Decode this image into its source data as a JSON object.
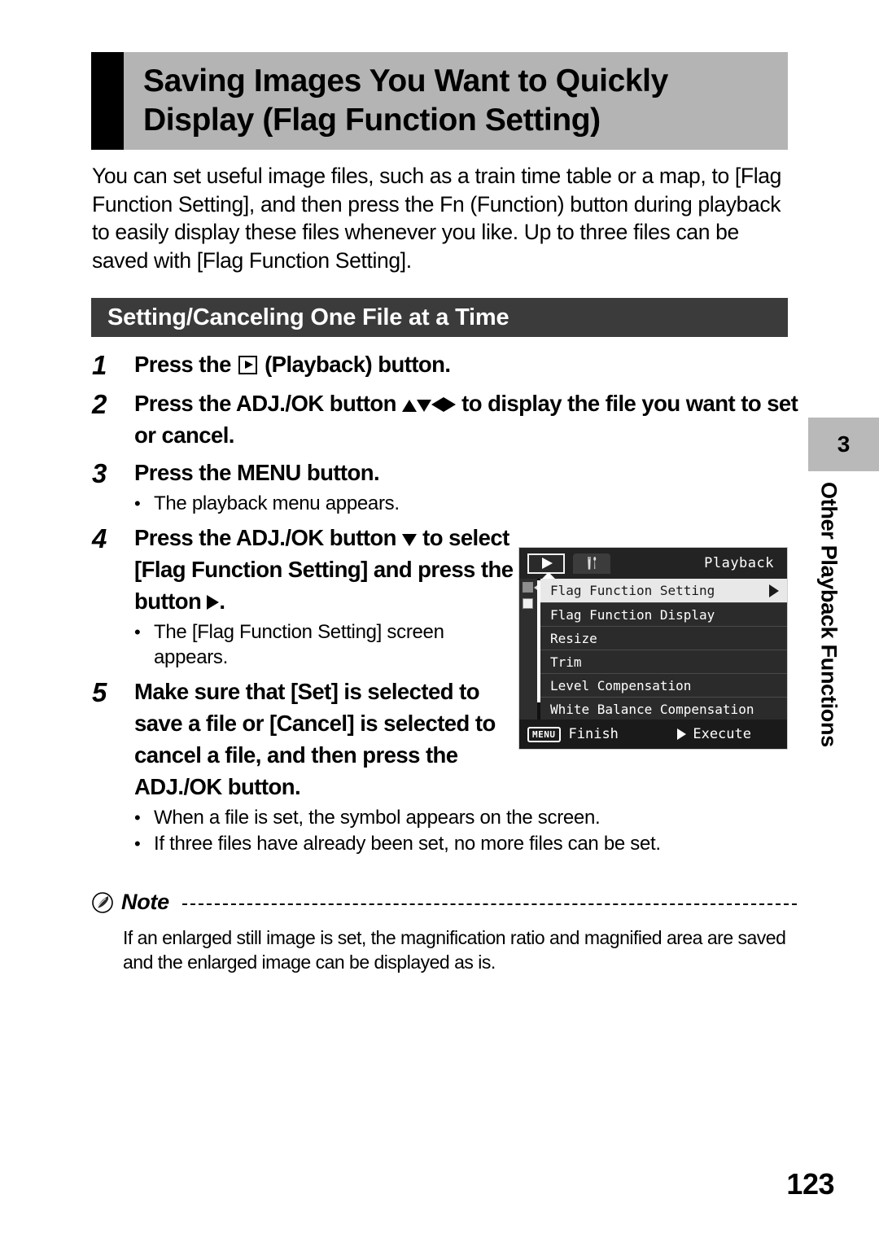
{
  "header": {
    "title_line1": "Saving Images You Want to Quickly",
    "title_line2": "Display (Flag Function Setting)"
  },
  "intro": {
    "paragraph": "You can set useful image files, such as a train time table or a map, to [Flag Function Setting], and then press the Fn (Function) button during playback to easily display these files whenever you like. Up to three files can be saved with [Flag Function Setting]."
  },
  "subsection": {
    "title": "Setting/Canceling One File at a Time"
  },
  "steps": [
    {
      "number": "1",
      "text_before": "Press the",
      "text_after": "(Playback) button."
    },
    {
      "number": "2",
      "text_before": "Press the ADJ./OK button",
      "text_after": "to display the file you want to set or cancel."
    },
    {
      "number": "3",
      "text": "Press the MENU button.",
      "bullets": [
        "The playback menu appears."
      ]
    },
    {
      "number": "4",
      "text_before": "Press the ADJ./OK button",
      "text_mid": "to select [Flag Function Setting] and press the button",
      "text_after": ".",
      "bullets": [
        "The [Flag Function Setting] screen appears."
      ]
    },
    {
      "number": "5",
      "text": "Make sure that [Set] is selected to save a file or [Cancel] is selected to cancel a file, and then press the ADJ./OK button.",
      "bullets": [
        "When a file is set, the symbol appears on the screen.",
        "If three files have already been set, no more files can be set."
      ]
    }
  ],
  "lcd": {
    "tabs": [
      {
        "icon": "playback-icon",
        "active": true
      },
      {
        "icon": "tools-icon",
        "active": false
      }
    ],
    "title": "Playback",
    "rows": [
      {
        "label": "Flag Function Setting",
        "selected": true,
        "arrow": true
      },
      {
        "label": "Flag Function Display",
        "selected": false,
        "arrow": false
      },
      {
        "label": "Resize",
        "selected": false,
        "arrow": false
      },
      {
        "label": "Trim",
        "selected": false,
        "arrow": false
      },
      {
        "label": "Level Compensation",
        "selected": false,
        "arrow": false
      },
      {
        "label": "White Balance Compensation",
        "selected": false,
        "arrow": false
      }
    ],
    "footer": {
      "menu_badge": "MENU",
      "finish_label": "Finish",
      "execute_label": "Execute"
    }
  },
  "note": {
    "label": "Note",
    "body": "If an enlarged still image is set, the magnification ratio and magnified area are saved and the enlarged image can be displayed as is."
  },
  "chapter": {
    "number": "3",
    "label": "Other Playback Functions"
  },
  "footer": {
    "page_number": "123"
  },
  "colors": {
    "title_bar_bg": "#b4b4b4",
    "title_block": "#000000",
    "subsection_bg": "#3b3b3b",
    "chapter_tab_bg": "#b9b9b9",
    "lcd_bg": "#1b1b1b",
    "lcd_row_selected_bg": "#e8e8e8"
  }
}
